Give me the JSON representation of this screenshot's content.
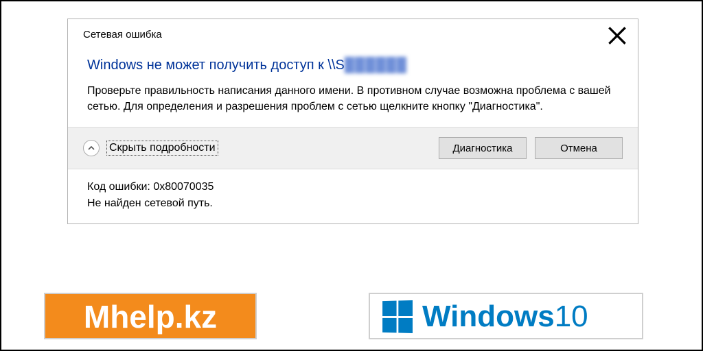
{
  "dialog": {
    "title": "Сетевая ошибка",
    "headline_prefix": "Windows не может получить доступ к \\\\S",
    "headline_blurred": "██████",
    "body": "Проверьте правильность написания данного имени. В противном случае возможна проблема с вашей сетью. Для определения и разрешения проблем с сетью щелкните кнопку \"Диагностика\".",
    "toggle_label": "Скрыть подробности",
    "diagnose_label": "Диагностика",
    "cancel_label": "Отмена",
    "error_code_label": "Код ошибки: 0x80070035",
    "error_desc": "Не найден сетевой путь."
  },
  "badges": {
    "mhelp": "Mhelp.kz",
    "windows_word": "Windows",
    "windows_ver": "10"
  }
}
